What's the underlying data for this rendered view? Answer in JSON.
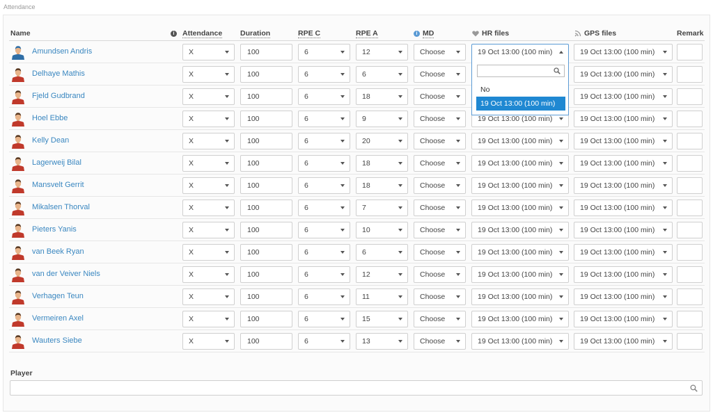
{
  "section_title": "Attendance",
  "columns": {
    "name": "Name",
    "attendance": "Attendance",
    "duration": "Duration",
    "rpe_c": "RPE C",
    "rpe_a": "RPE A",
    "md": "MD",
    "hr_files": "HR files",
    "gps_files": "GPS files",
    "remark": "Remark"
  },
  "icons": {
    "name_info": "info-icon",
    "md_info": "info-icon",
    "hr_files": "heart-icon",
    "gps_files": "gps-signal-icon"
  },
  "colors": {
    "link": "#3a87c0",
    "highlight": "#1f88d2",
    "focus_border": "#5b9bd5"
  },
  "players": [
    {
      "name": "Amundsen Andris",
      "attendance": "X",
      "duration": "100",
      "rpe_c": "6",
      "rpe_a": "12",
      "md": "Choose",
      "hr": "19 Oct 13:00 (100 min)",
      "gps": "19 Oct 13:00 (100 min)",
      "remark": "",
      "kit": "blue"
    },
    {
      "name": "Delhaye Mathis",
      "attendance": "X",
      "duration": "100",
      "rpe_c": "6",
      "rpe_a": "6",
      "md": "Choose",
      "hr": "19 Oct 13:00 (100 min)",
      "gps": "19 Oct 13:00 (100 min)",
      "remark": "",
      "kit": "red"
    },
    {
      "name": "Fjeld Gudbrand",
      "attendance": "X",
      "duration": "100",
      "rpe_c": "6",
      "rpe_a": "18",
      "md": "Choose",
      "hr": "19 Oct 13:00 (100 min)",
      "gps": "19 Oct 13:00 (100 min)",
      "remark": "",
      "kit": "red"
    },
    {
      "name": "Hoel Ebbe",
      "attendance": "X",
      "duration": "100",
      "rpe_c": "6",
      "rpe_a": "9",
      "md": "Choose",
      "hr": "19 Oct 13:00 (100 min)",
      "gps": "19 Oct 13:00 (100 min)",
      "remark": "",
      "kit": "red"
    },
    {
      "name": "Kelly Dean",
      "attendance": "X",
      "duration": "100",
      "rpe_c": "6",
      "rpe_a": "20",
      "md": "Choose",
      "hr": "19 Oct 13:00 (100 min)",
      "gps": "19 Oct 13:00 (100 min)",
      "remark": "",
      "kit": "red"
    },
    {
      "name": "Lagerweij Bilal",
      "attendance": "X",
      "duration": "100",
      "rpe_c": "6",
      "rpe_a": "18",
      "md": "Choose",
      "hr": "19 Oct 13:00 (100 min)",
      "gps": "19 Oct 13:00 (100 min)",
      "remark": "",
      "kit": "red"
    },
    {
      "name": "Mansvelt Gerrit",
      "attendance": "X",
      "duration": "100",
      "rpe_c": "6",
      "rpe_a": "18",
      "md": "Choose",
      "hr": "19 Oct 13:00 (100 min)",
      "gps": "19 Oct 13:00 (100 min)",
      "remark": "",
      "kit": "red"
    },
    {
      "name": "Mikalsen Thorval",
      "attendance": "X",
      "duration": "100",
      "rpe_c": "6",
      "rpe_a": "7",
      "md": "Choose",
      "hr": "19 Oct 13:00 (100 min)",
      "gps": "19 Oct 13:00 (100 min)",
      "remark": "",
      "kit": "red"
    },
    {
      "name": "Pieters Yanis",
      "attendance": "X",
      "duration": "100",
      "rpe_c": "6",
      "rpe_a": "10",
      "md": "Choose",
      "hr": "19 Oct 13:00 (100 min)",
      "gps": "19 Oct 13:00 (100 min)",
      "remark": "",
      "kit": "red"
    },
    {
      "name": "van Beek Ryan",
      "attendance": "X",
      "duration": "100",
      "rpe_c": "6",
      "rpe_a": "6",
      "md": "Choose",
      "hr": "19 Oct 13:00 (100 min)",
      "gps": "19 Oct 13:00 (100 min)",
      "remark": "",
      "kit": "red"
    },
    {
      "name": "van der Veiver Niels",
      "attendance": "X",
      "duration": "100",
      "rpe_c": "6",
      "rpe_a": "12",
      "md": "Choose",
      "hr": "19 Oct 13:00 (100 min)",
      "gps": "19 Oct 13:00 (100 min)",
      "remark": "",
      "kit": "red"
    },
    {
      "name": "Verhagen Teun",
      "attendance": "X",
      "duration": "100",
      "rpe_c": "6",
      "rpe_a": "11",
      "md": "Choose",
      "hr": "19 Oct 13:00 (100 min)",
      "gps": "19 Oct 13:00 (100 min)",
      "remark": "",
      "kit": "red"
    },
    {
      "name": "Vermeiren Axel",
      "attendance": "X",
      "duration": "100",
      "rpe_c": "6",
      "rpe_a": "15",
      "md": "Choose",
      "hr": "19 Oct 13:00 (100 min)",
      "gps": "19 Oct 13:00 (100 min)",
      "remark": "",
      "kit": "red"
    },
    {
      "name": "Wauters Siebe",
      "attendance": "X",
      "duration": "100",
      "rpe_c": "6",
      "rpe_a": "13",
      "md": "Choose",
      "hr": "19 Oct 13:00 (100 min)",
      "gps": "19 Oct 13:00 (100 min)",
      "remark": "",
      "kit": "red"
    }
  ],
  "hr_dropdown": {
    "search_value": "",
    "options": [
      "No",
      "19 Oct 13:00 (100 min)"
    ],
    "highlighted": "19 Oct 13:00 (100 min)"
  },
  "player_search": {
    "label": "Player",
    "value": ""
  }
}
